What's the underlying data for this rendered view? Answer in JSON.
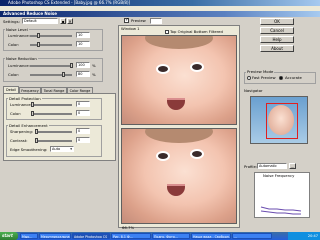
{
  "window": {
    "title": "Adobe Photoshop CS Extended - [Baby.jpg @ 66.7% (RGB/8)]"
  },
  "dialog": {
    "title": "Advanced Reduce Noise"
  },
  "toolbar": {
    "settings_label": "Settings:",
    "settings_value": "Default",
    "preview_label": "Preview",
    "zoom_value": "66.7%"
  },
  "side_buttons": [
    "OK",
    "Cancel",
    "Help",
    "About"
  ],
  "noise_level": {
    "title": "Noise Level",
    "luminance_label": "Luminance:",
    "luminance_value": "10",
    "color_label": "Color:",
    "color_value": "10"
  },
  "noise_reduction": {
    "title": "Noise Reduction",
    "luminance_label": "Luminance:",
    "luminance_value": "100",
    "luminance_unit": "%",
    "color_label": "Color:",
    "color_value": "80",
    "color_unit": "%"
  },
  "tabs": [
    "Detail",
    "Frequency",
    "Tonal Range",
    "Color Range"
  ],
  "detail_protection": {
    "title": "Detail Protection",
    "luminance_label": "Luminance:",
    "luminance_value": "0",
    "color_label": "Color:",
    "color_value": "0"
  },
  "detail_enhancement": {
    "title": "Detail Enhancement",
    "sharpening_label": "Sharpening:",
    "sharpening_value": "0",
    "contrast_label": "Contrast:",
    "contrast_value": "0",
    "edge_label": "Edge Smoothening:",
    "edge_value": "Auto"
  },
  "preview_header": {
    "window_label": "Window 1",
    "top_label": "Top Original Bottom Filtered"
  },
  "preview_mode": {
    "title": "Preview Mode",
    "option1": "Fast Preview",
    "option2": "Accurate"
  },
  "navigator": {
    "title": "Navigator"
  },
  "profile": {
    "label": "Profile:",
    "value": "Automatic",
    "graph_title": "Noise Frequency"
  },
  "status": {
    "zoom": "66.7%"
  },
  "taskbar": {
    "start": "start",
    "items": [
      "Мыр...",
      "Мерунниксальная-Ph...",
      "Adobe Photoshop CS",
      "Рис. 8.1 Ф...",
      "Подгр. Фото...",
      "Наши вида - Свободн...",
      "..."
    ],
    "clock": "20:47"
  },
  "colors": {
    "titlebar": "#0a246a",
    "dialog_bg": "#d4d0c8",
    "taskbar": "#245edb"
  }
}
